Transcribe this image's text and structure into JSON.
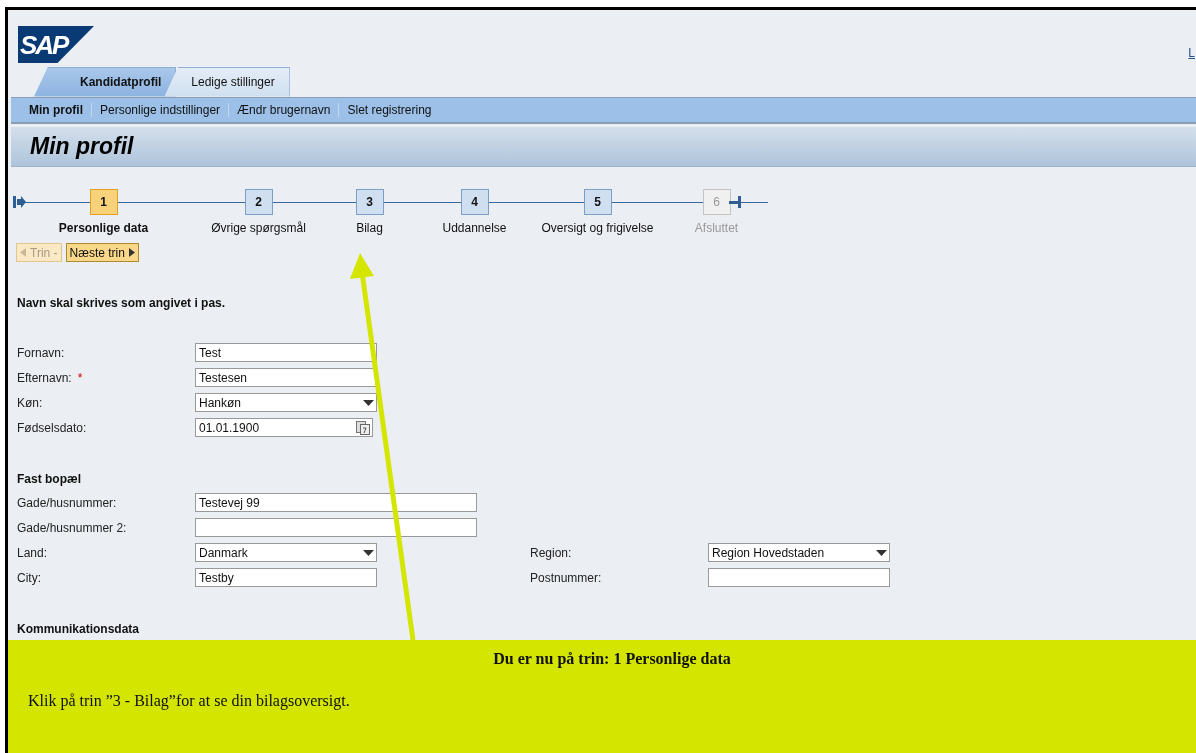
{
  "header": {
    "logo": "SAP",
    "link": "L"
  },
  "tabs": [
    {
      "label": "Kandidatprofil",
      "selected": true
    },
    {
      "label": "Ledige stillinger",
      "selected": false
    }
  ],
  "subnav": [
    {
      "label": "Min profil",
      "selected": true
    },
    {
      "label": "Personlige indstillinger",
      "selected": false
    },
    {
      "label": "Ændr brugernavn",
      "selected": false
    },
    {
      "label": "Slet registrering",
      "selected": false
    }
  ],
  "page_title": "Min profil",
  "steps": [
    {
      "number": "1",
      "label": "Personlige data",
      "selected": true,
      "disabled": false
    },
    {
      "number": "2",
      "label": "Øvrige spørgsmål",
      "selected": false,
      "disabled": false
    },
    {
      "number": "3",
      "label": "Bilag",
      "selected": false,
      "disabled": false
    },
    {
      "number": "4",
      "label": "Uddannelse",
      "selected": false,
      "disabled": false
    },
    {
      "number": "5",
      "label": "Oversigt og frigivelse",
      "selected": false,
      "disabled": false
    },
    {
      "number": "6",
      "label": "Afsluttet",
      "selected": false,
      "disabled": true
    }
  ],
  "step_buttons": [
    {
      "kind": "prev",
      "label": "Trin -",
      "disabled": true
    },
    {
      "kind": "next",
      "label": "Næste trin",
      "disabled": false
    }
  ],
  "sections": [
    {
      "heading": "Navn skal skrives som angivet i pas.",
      "rows": [
        {
          "fields": [
            {
              "label": "Fornavn:",
              "kind": "text",
              "value": "Test"
            }
          ]
        },
        {
          "fields": [
            {
              "label": "Efternavn:",
              "required_mark": "*",
              "kind": "text",
              "value": "Testesen"
            }
          ]
        },
        {
          "fields": [
            {
              "label": "Køn:",
              "kind": "select",
              "value": "Hankøn"
            }
          ]
        },
        {
          "fields": [
            {
              "label": "Fødselsdato:",
              "kind": "date",
              "value": "01.01.1900"
            }
          ]
        }
      ]
    },
    {
      "heading": "Fast bopæl",
      "rows": [
        {
          "fields": [
            {
              "label": "Gade/husnummer:",
              "kind": "text_long",
              "value": "Testevej 99"
            }
          ]
        },
        {
          "fields": [
            {
              "label": "Gade/husnummer 2:",
              "kind": "text_long"
            }
          ]
        },
        {
          "fields": [
            {
              "label": "Land:",
              "kind": "select",
              "value": "Danmark"
            },
            {
              "label": "Region:",
              "kind": "select",
              "value": "Region Hovedstaden"
            }
          ]
        },
        {
          "fields": [
            {
              "label": "City:",
              "kind": "text",
              "value": "Testby"
            },
            {
              "label": "Postnummer:",
              "kind": "text"
            }
          ]
        }
      ]
    },
    {
      "heading": "Kommunikationsdata"
    }
  ],
  "callout": {
    "title": "Du er nu på trin: 1 Personlige data",
    "text": "Klik på trin ”3 - Bilag”for at se din bilagsoversigt."
  }
}
